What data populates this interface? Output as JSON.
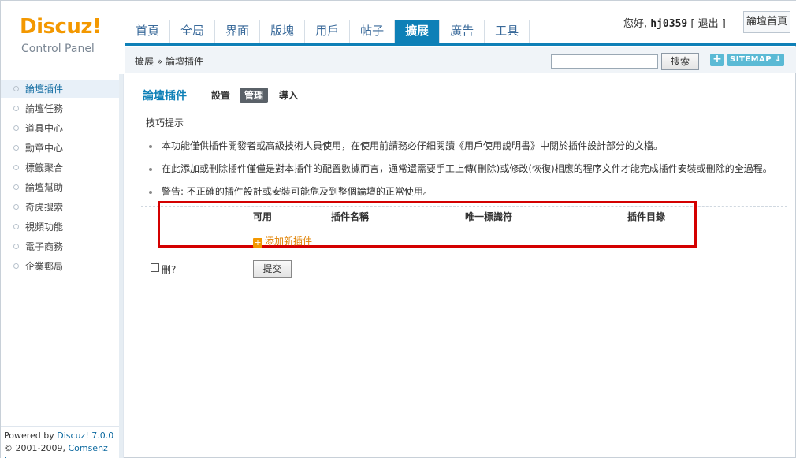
{
  "header": {
    "logo_text": "Discuz!",
    "logo_sub": "Control Panel",
    "nav": [
      "首頁",
      "全局",
      "界面",
      "版塊",
      "用戶",
      "帖子",
      "擴展",
      "廣告",
      "工具"
    ],
    "active_nav": "擴展",
    "greeting": "您好,",
    "username": "hj0359",
    "logout": "[ 退出 ]",
    "forum_home": "論壇首頁"
  },
  "subbar": {
    "breadcrumb": "擴展 » 論壇插件",
    "search_value": "",
    "search_button": "搜索",
    "plus_button": "+",
    "sitemap_button": "SITEMAP ↓"
  },
  "sidebar": {
    "items": [
      "論壇插件",
      "論壇任務",
      "道具中心",
      "勳章中心",
      "標籤聚合",
      "論壇幫助",
      "奇虎搜索",
      "視頻功能",
      "電子商務",
      "企業郵局"
    ],
    "active_item": "論壇插件",
    "footer_line1_prefix": "Powered by",
    "footer_line1_brand": "Discuz! 7.0.0",
    "footer_line2_prefix": "© 2001-2009,",
    "footer_line2_brand": "Comsenz Inc."
  },
  "main": {
    "title": "論壇插件",
    "tabs": [
      "設置",
      "管理",
      "導入"
    ],
    "active_tab": "管理",
    "tips_title": "技巧提示",
    "tips": [
      "本功能僅供插件開發者或高級技術人員使用，在使用前請務必仔細閱讀《用戶使用說明書》中關於插件設計部分的文檔。",
      "在此添加或刪除插件僅僅是對本插件的配置數據而言，通常還需要手工上傳(刪除)或修改(恢復)相應的程序文件才能完成插件安裝或刪除的全過程。",
      "警告: 不正確的插件設計或安裝可能危及到整個論壇的正常使用。"
    ],
    "table_headers": [
      "可用",
      "插件名稱",
      "唯一標識符",
      "插件目錄"
    ],
    "add_plugin": "添加新插件",
    "delete_label": "刪?",
    "delete_checked": false,
    "submit_button": "提交"
  }
}
